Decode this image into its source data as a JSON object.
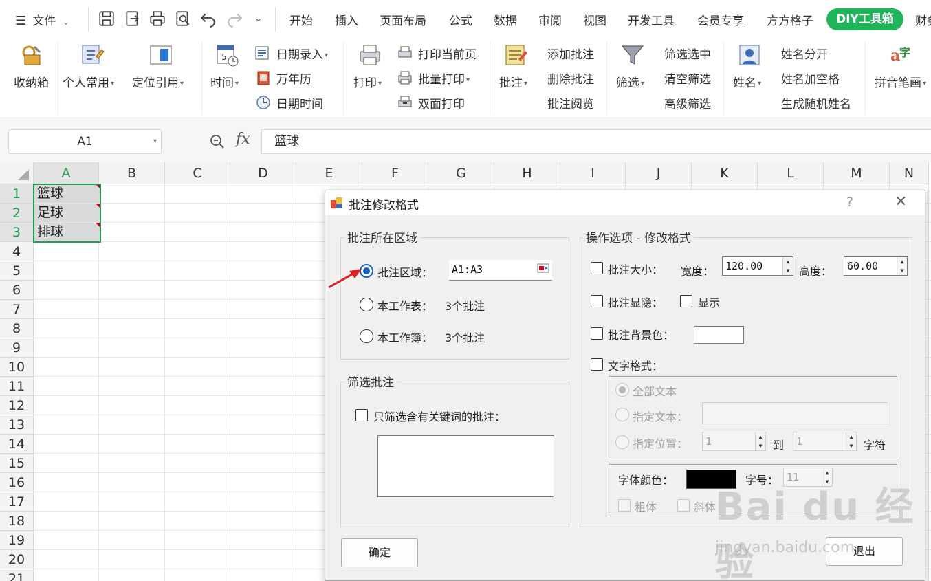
{
  "menu": {
    "hamburger_label": "文件",
    "tabs": [
      "开始",
      "插入",
      "页面布局",
      "公式",
      "数据",
      "审阅",
      "视图",
      "开发工具",
      "会员专享",
      "方方格子"
    ],
    "active_tab": "DIY工具箱",
    "overflow_tab": "财务"
  },
  "ribbon": {
    "storage": "收纳箱",
    "personal": "个人常用",
    "locate": "定位引用",
    "time": "时间",
    "date_entry": "日期录入",
    "calendar": "万年历",
    "datetime": "日期时间",
    "print": "打印",
    "print_current": "打印当前页",
    "batch_print": "批量打印",
    "duplex_print": "双面打印",
    "comment": "批注",
    "add_comment": "添加批注",
    "delete_comment": "删除批注",
    "read_comment": "批注阅览",
    "filter": "筛选",
    "filter_selected": "筛选选中",
    "clear_filter": "清空筛选",
    "advanced_filter": "高级筛选",
    "name": "姓名",
    "split_name": "姓名分开",
    "name_space": "姓名加空格",
    "random_name": "生成随机姓名",
    "pinyin": "拼音笔画"
  },
  "formula_bar": {
    "cell_ref": "A1",
    "fx": "fx",
    "value": "篮球"
  },
  "sheet": {
    "columns": [
      "A",
      "B",
      "C",
      "D",
      "E",
      "F",
      "G",
      "H",
      "I",
      "J",
      "K",
      "L",
      "M",
      "N"
    ],
    "rows": [
      "1",
      "2",
      "3",
      "4",
      "5",
      "6",
      "7",
      "8",
      "9",
      "10",
      "11",
      "12",
      "13",
      "14",
      "15",
      "16",
      "17",
      "18",
      "19",
      "20",
      "21"
    ],
    "cells": [
      "篮球",
      "足球",
      "排球"
    ]
  },
  "dialog": {
    "title": "批注修改格式",
    "help": "?",
    "close": "✕",
    "area_group": "批注所在区域",
    "area_option": "批注区域：",
    "area_value": "A1:A3",
    "sheet_option": "本工作表：",
    "sheet_count": "3个批注",
    "book_option": "本工作簿：",
    "book_count": "3个批注",
    "filter_group": "筛选批注",
    "filter_keyword": "只筛选含有关键词的批注：",
    "ops_group": "操作选项 - 修改格式",
    "size_label": "批注大小：",
    "width_label": "宽度：",
    "width_value": "120.00",
    "height_label": "高度：",
    "height_value": "60.00",
    "visibility_label": "批注显隐：",
    "show_label": "显示",
    "bg_label": "批注背景色：",
    "text_format": "文字格式：",
    "all_text": "全部文本",
    "specified_text": "指定文本：",
    "specified_pos": "指定位置：",
    "pos_from": "1",
    "pos_to_label": "到",
    "pos_to": "1",
    "char_label": "字符",
    "font_color_label": "字体颜色：",
    "font_size_label": "字号：",
    "font_size_value": "11",
    "bold": "粗体",
    "italic": "斜体",
    "ok": "确定",
    "exit": "退出"
  },
  "watermark": {
    "text": "Bai du 经验",
    "url": "jingyan.baidu.com"
  },
  "colors": {
    "accent_green": "#1fb45a",
    "selection_green": "#1f9d55",
    "radio_blue": "#1565c0",
    "comment_marker": "#d0021b"
  }
}
